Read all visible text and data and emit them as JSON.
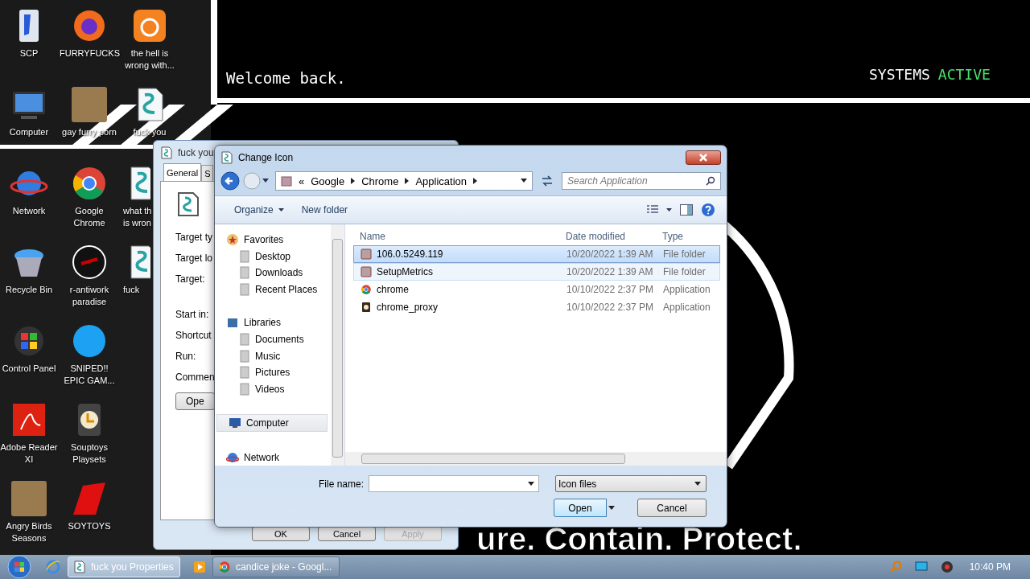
{
  "wallpaper": {
    "greeting": "Welcome back.",
    "status_label": "SYSTEMS",
    "status_value": "ACTIVE",
    "motto": "ure. Contain. Protect."
  },
  "desktop_icons": [
    {
      "label": "SCP",
      "kind": "shortcut"
    },
    {
      "label": "Computer",
      "kind": "monitor"
    },
    {
      "label": "Network",
      "kind": "globe"
    },
    {
      "label": "Recycle Bin",
      "kind": "bin"
    },
    {
      "label": "Control Panel",
      "kind": "windows"
    },
    {
      "label": "Adobe Reader XI",
      "kind": "pdf"
    },
    {
      "label": "Angry Birds Seasons",
      "kind": "photo"
    },
    {
      "label": "FURRYFUCKS",
      "kind": "firefox"
    },
    {
      "label": "gay furry porn",
      "kind": "photo"
    },
    {
      "label": "Google Chrome",
      "kind": "chrome"
    },
    {
      "label": "r-antiwork paradise",
      "kind": "badge"
    },
    {
      "label": "SNIPED!! EPIC GAM...",
      "kind": "skype"
    },
    {
      "label": "Souptoys Playsets",
      "kind": "clock"
    },
    {
      "label": "SOYTOYS",
      "kind": "logo"
    },
    {
      "label": "the hell is wrong with...",
      "kind": "tile"
    },
    {
      "label": "fuck you",
      "kind": "script"
    },
    {
      "label": "what th is wron",
      "kind": "script"
    },
    {
      "label": "fuck",
      "kind": "script"
    }
  ],
  "properties_window": {
    "title": "fuck you",
    "tabs": [
      {
        "label": "General",
        "selected": true
      },
      {
        "label": "S",
        "selected": false
      }
    ],
    "fields": [
      "Target ty",
      "Target lo",
      "Target:",
      "Start in:",
      "Shortcut",
      "Run:",
      "Commen"
    ],
    "open_button": "Ope",
    "buttons": [
      {
        "label": "OK",
        "disabled": false
      },
      {
        "label": "Cancel",
        "disabled": false
      },
      {
        "label": "Apply",
        "disabled": true
      }
    ]
  },
  "dialog": {
    "title": "Change Icon",
    "breadcrumbs": [
      "Google",
      "Chrome",
      "Application"
    ],
    "overflow": "«",
    "search": {
      "placeholder": "Search Application"
    },
    "toolbar": [
      "Organize",
      "New folder"
    ],
    "nav": [
      {
        "label": "Favorites",
        "kind": "favorites",
        "selected": false,
        "children": [
          {
            "label": "Desktop",
            "kind": "folder",
            "selected": false
          },
          {
            "label": "Downloads",
            "kind": "folder",
            "selected": false
          },
          {
            "label": "Recent Places",
            "kind": "folder",
            "selected": false
          }
        ]
      },
      {
        "label": "Libraries",
        "kind": "library",
        "selected": false,
        "children": [
          {
            "label": "Documents",
            "kind": "folder",
            "selected": false
          },
          {
            "label": "Music",
            "kind": "folder",
            "selected": false
          },
          {
            "label": "Pictures",
            "kind": "folder",
            "selected": false
          },
          {
            "label": "Videos",
            "kind": "folder",
            "selected": false
          }
        ]
      },
      {
        "label": "Computer",
        "kind": "computer",
        "selected": true
      },
      {
        "label": "Network",
        "kind": "network",
        "selected": false
      }
    ],
    "columns": [
      "Name",
      "Date modified",
      "Type"
    ],
    "files": [
      {
        "name": "106.0.5249.119",
        "date": "10/20/2022 1:39 AM",
        "type": "File folder",
        "kind": "folder",
        "selected": true,
        "hovered": false
      },
      {
        "name": "SetupMetrics",
        "date": "10/20/2022 1:39 AM",
        "type": "File folder",
        "kind": "folder",
        "selected": false,
        "hovered": true
      },
      {
        "name": "chrome",
        "date": "10/10/2022 2:37 PM",
        "type": "Application",
        "kind": "chrome",
        "selected": false,
        "hovered": false
      },
      {
        "name": "chrome_proxy",
        "date": "10/10/2022 2:37 PM",
        "type": "Application",
        "kind": "app",
        "selected": false,
        "hovered": false
      }
    ],
    "file_name_label": "File name:",
    "filter": "Icon files",
    "open_button": "Open",
    "cancel_button": "Cancel"
  },
  "taskbar": {
    "tasks": [
      {
        "label": "fuck you Properties",
        "kind": "properties",
        "selected": true
      },
      {
        "label": "candice joke - Googl...",
        "kind": "chrome",
        "selected": false
      }
    ],
    "clock": "10:40 PM"
  }
}
